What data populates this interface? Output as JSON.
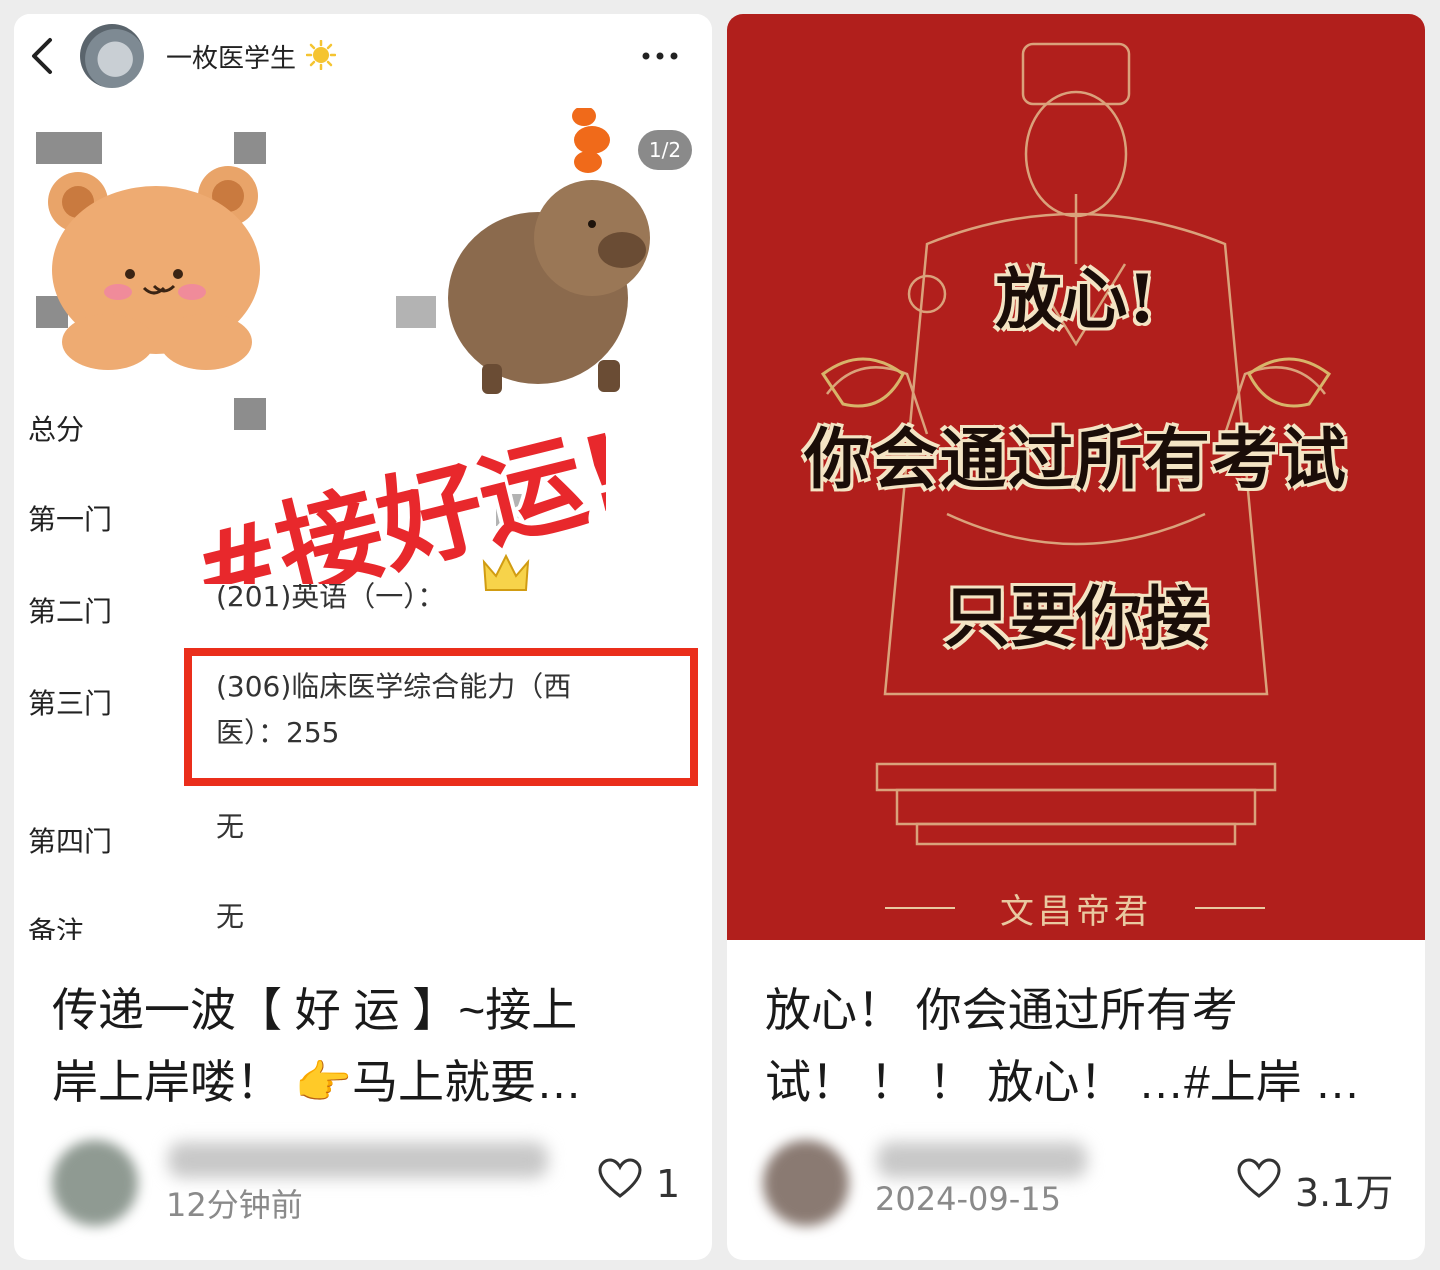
{
  "left_post": {
    "author": "一枚医学生",
    "page_indicator": "1/2",
    "score_rows": [
      {
        "label": "总分",
        "value": ""
      },
      {
        "label": "第一门",
        "value": ""
      },
      {
        "label": "第二门",
        "value": "(201)英语（一）："
      },
      {
        "label": "第三门",
        "value": "(306)临床医学综合能力（西",
        "value2": "医）：255"
      },
      {
        "label": "第四门",
        "value": "无"
      },
      {
        "label": "备注",
        "value": "无"
      }
    ],
    "sticker_text": "#接好运!",
    "caption_line1": "传递一波【 好 运 】~接上",
    "caption_line2": "岸上岸喽！ 👉马上就要…",
    "time": "12分钟前",
    "likes": "1"
  },
  "right_post": {
    "poster_line1": "放心!",
    "poster_line2": "你会通过所有考试",
    "poster_line3": "只要你接",
    "poster_signature": "文昌帝君",
    "caption_line1": "放心！ 你会通过所有考",
    "caption_line2": "试！ ！ ！  放心！ …#上岸 …",
    "time": "2024-09-15",
    "likes": "3.1万"
  },
  "colors": {
    "highlight_red": "#ea2e1b",
    "poster_red": "#b11f1c",
    "text_dark": "#1a1a1a",
    "text_muted": "#8a8a8a"
  },
  "icons": [
    "back-icon",
    "sun-icon",
    "more-icon",
    "heart-icon",
    "pointing-hand-icon",
    "crown-icon"
  ]
}
